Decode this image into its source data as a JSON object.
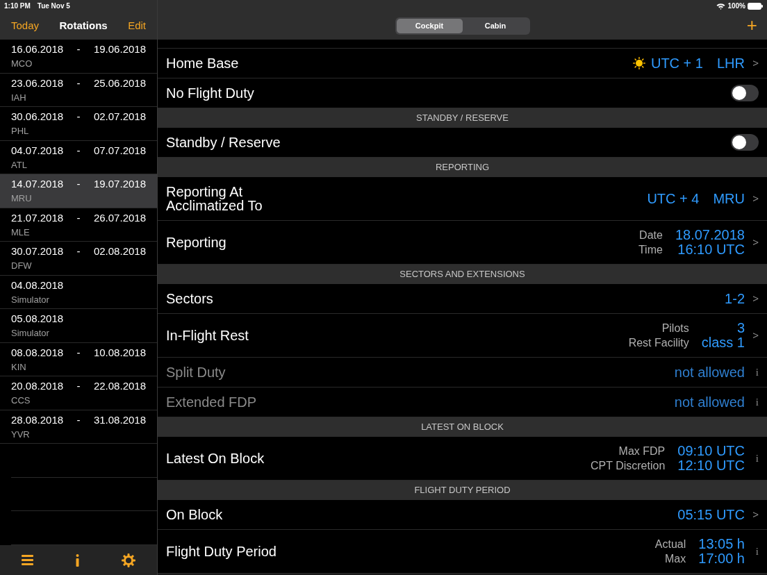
{
  "status_bar": {
    "time": "1:10 PM",
    "date": "Tue Nov 5",
    "battery": "100%"
  },
  "sidebar": {
    "nav": {
      "left": "Today",
      "title": "Rotations",
      "right": "Edit"
    },
    "items": [
      {
        "start": "16.06.2018",
        "sep": "-",
        "end": "19.06.2018",
        "sub": "MCO",
        "selected": false
      },
      {
        "start": "23.06.2018",
        "sep": "-",
        "end": "25.06.2018",
        "sub": "IAH",
        "selected": false
      },
      {
        "start": "30.06.2018",
        "sep": "-",
        "end": "02.07.2018",
        "sub": "PHL",
        "selected": false
      },
      {
        "start": "04.07.2018",
        "sep": "-",
        "end": "07.07.2018",
        "sub": "ATL",
        "selected": false
      },
      {
        "start": "14.07.2018",
        "sep": "-",
        "end": "19.07.2018",
        "sub": "MRU",
        "selected": true
      },
      {
        "start": "21.07.2018",
        "sep": "-",
        "end": "26.07.2018",
        "sub": "MLE",
        "selected": false
      },
      {
        "start": "30.07.2018",
        "sep": "-",
        "end": "02.08.2018",
        "sub": "DFW",
        "selected": false
      },
      {
        "start": "04.08.2018",
        "sub": "Simulator",
        "selected": false
      },
      {
        "start": "05.08.2018",
        "sub": "Simulator",
        "selected": false
      },
      {
        "start": "08.08.2018",
        "sep": "-",
        "end": "10.08.2018",
        "sub": "KIN",
        "selected": false
      },
      {
        "start": "20.08.2018",
        "sep": "-",
        "end": "22.08.2018",
        "sub": "CCS",
        "selected": false
      },
      {
        "start": "28.08.2018",
        "sep": "-",
        "end": "31.08.2018",
        "sub": "YVR",
        "selected": false
      }
    ]
  },
  "tabs": [
    {
      "label": "Cockpit",
      "selected": true
    },
    {
      "label": "Cabin",
      "selected": false
    }
  ],
  "add_button": "+",
  "rows": [
    {
      "kind": "base",
      "label": [
        "Home Base"
      ],
      "values": [
        "UTC + 1",
        "LHR"
      ],
      "accessory": ">",
      "disabled": false
    },
    {
      "kind": "toggle",
      "label": [
        "No Flight Duty"
      ],
      "on": false,
      "disabled": false
    },
    {
      "kind": "header",
      "label": [
        "STANDBY / RESERVE"
      ]
    },
    {
      "kind": "toggle",
      "label": [
        "Standby / Reserve"
      ],
      "on": false,
      "disabled": false
    },
    {
      "kind": "header",
      "label": [
        "REPORTING"
      ]
    },
    {
      "kind": "value",
      "label": [
        "Reporting At",
        "Acclimatized To"
      ],
      "values": [
        "UTC + 4",
        "MRU"
      ],
      "accessory": ">",
      "disabled": false
    },
    {
      "kind": "detail",
      "label": [
        "Reporting"
      ],
      "pairs": [
        {
          "label": "Date",
          "value": "18.07.2018"
        },
        {
          "label": "Time",
          "value": "16:10 UTC"
        }
      ],
      "accessory": ">",
      "disabled": false
    },
    {
      "kind": "header",
      "label": [
        "SECTORS AND EXTENSIONS"
      ]
    },
    {
      "kind": "value",
      "label": [
        "Sectors"
      ],
      "values": [
        "1-2"
      ],
      "accessory": ">",
      "disabled": false
    },
    {
      "kind": "detail",
      "label": [
        "In-Flight Rest"
      ],
      "pairs": [
        {
          "label": "Pilots",
          "value": "3"
        },
        {
          "label": "Rest Facility",
          "value": "class 1"
        }
      ],
      "accessory": ">",
      "disabled": false
    },
    {
      "kind": "value",
      "label": [
        "Split Duty"
      ],
      "values": [
        "not allowed"
      ],
      "accessory": "i",
      "disabled": true
    },
    {
      "kind": "value",
      "label": [
        "Extended FDP"
      ],
      "values": [
        "not allowed"
      ],
      "accessory": "i",
      "disabled": true
    },
    {
      "kind": "header",
      "label": [
        "LATEST ON BLOCK"
      ]
    },
    {
      "kind": "detail",
      "label": [
        "Latest On Block"
      ],
      "pairs": [
        {
          "label": "Max FDP",
          "value": "09:10 UTC"
        },
        {
          "label": "CPT Discretion",
          "value": "12:10 UTC"
        }
      ],
      "accessory": "i",
      "disabled": false
    },
    {
      "kind": "header",
      "label": [
        "FLIGHT DUTY PERIOD"
      ]
    },
    {
      "kind": "value",
      "label": [
        "On Block"
      ],
      "values": [
        "05:15 UTC"
      ],
      "accessory": ">",
      "disabled": false
    },
    {
      "kind": "detail",
      "label": [
        "Flight Duty Period"
      ],
      "pairs": [
        {
          "label": "Actual",
          "value": "13:05 h"
        },
        {
          "label": "Max",
          "value": "17:00 h"
        }
      ],
      "accessory": "i",
      "disabled": false
    }
  ]
}
